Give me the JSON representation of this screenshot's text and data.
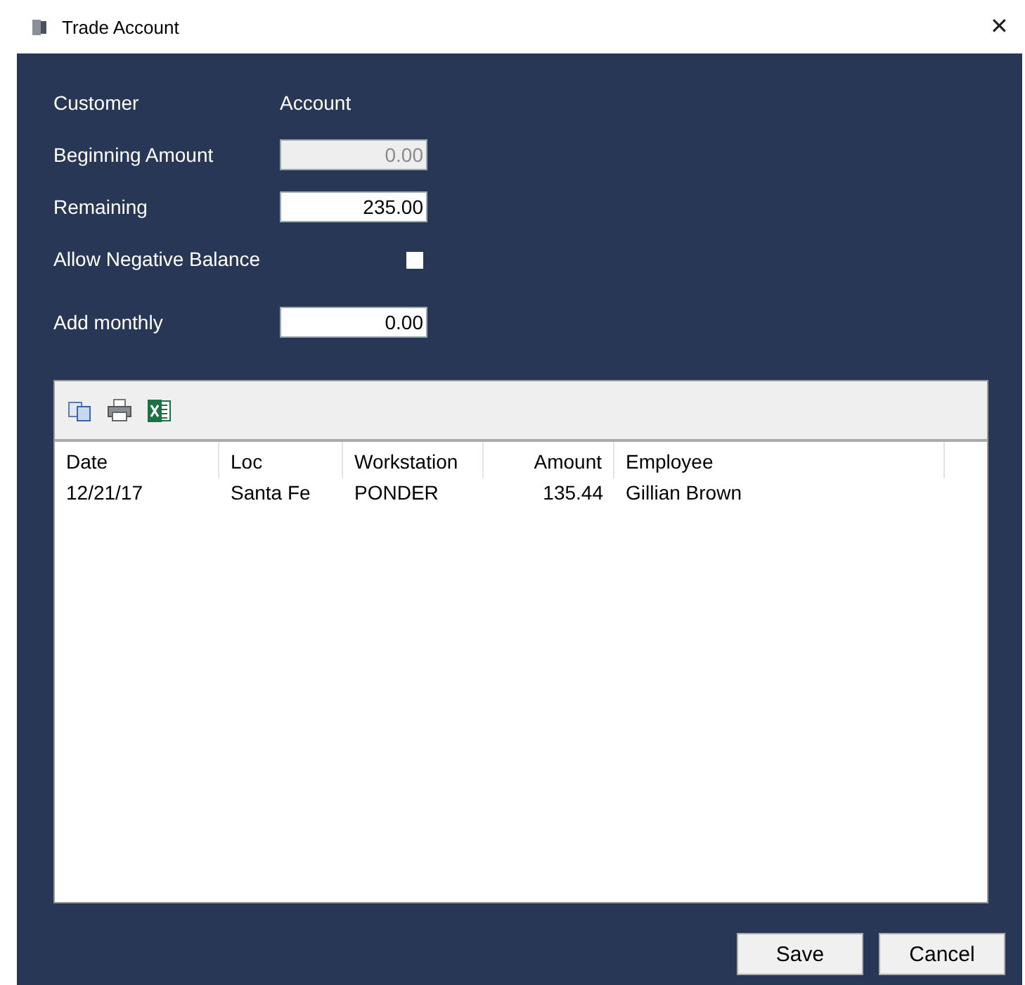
{
  "window": {
    "title": "Trade Account",
    "close": "✕"
  },
  "header": {
    "label": "Customer",
    "value": "Account"
  },
  "form": [
    {
      "kind": "field",
      "label": "Beginning Amount",
      "value": "0.00",
      "disabled": true
    },
    {
      "kind": "field",
      "label": "Remaining",
      "value": "235.00",
      "disabled": false
    },
    {
      "kind": "checkbox",
      "label": "Allow Negative Balance",
      "checked": false
    },
    {
      "kind": "field",
      "label": "Add monthly",
      "value": "0.00",
      "disabled": false
    }
  ],
  "table": {
    "columns": [
      {
        "label": "Date",
        "numeric": false
      },
      {
        "label": "Loc",
        "numeric": false
      },
      {
        "label": "Workstation",
        "numeric": false
      },
      {
        "label": "Amount",
        "numeric": true
      },
      {
        "label": "Employee",
        "numeric": false
      }
    ],
    "rows": [
      [
        "12/21/17",
        "Santa Fe",
        "PONDER",
        "135.44",
        "Gillian Brown"
      ]
    ]
  },
  "buttons": [
    "Save",
    "Cancel"
  ]
}
